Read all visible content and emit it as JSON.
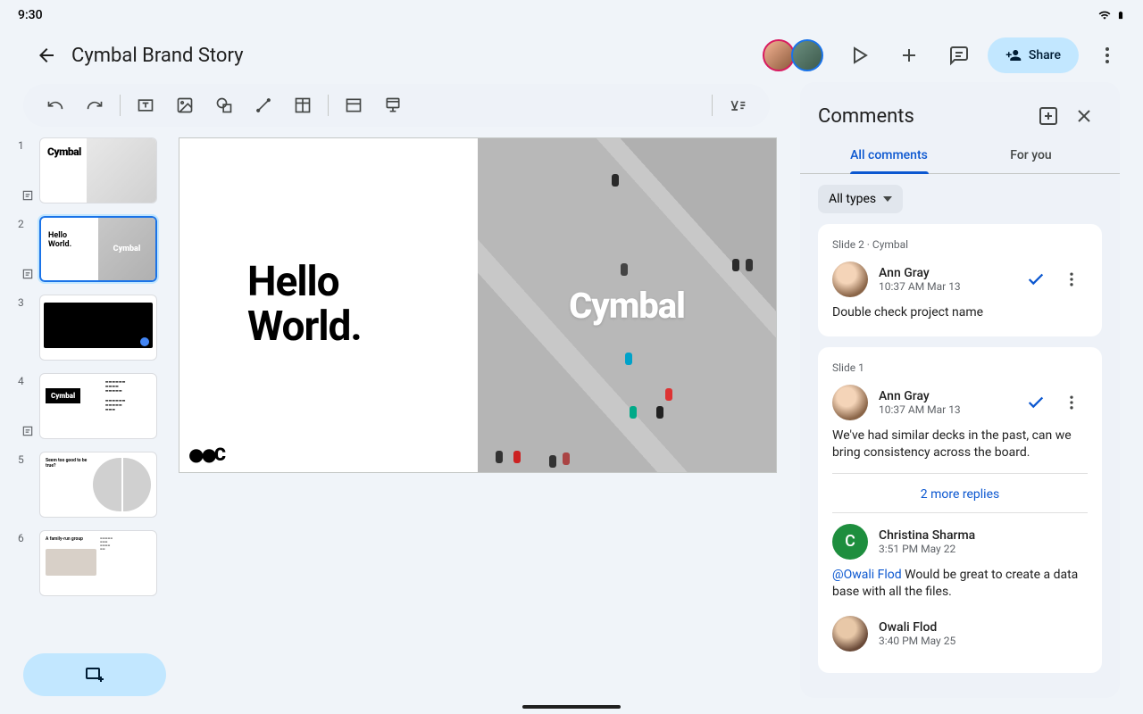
{
  "status": {
    "time": "9:30"
  },
  "header": {
    "title": "Cymbal Brand Story",
    "share_label": "Share"
  },
  "canvas": {
    "title_line1": "Hello",
    "title_line2": "World.",
    "brand": "Cymbal",
    "corner_mark": "⚫⚫C"
  },
  "thumbnails": [
    {
      "num": "1",
      "logo": "Cymbal"
    },
    {
      "num": "2",
      "text": "Hello\nWorld.",
      "logo": "Cymbal"
    },
    {
      "num": "3"
    },
    {
      "num": "4",
      "logo": "Cymbal"
    },
    {
      "num": "5",
      "text": "Seem too good\nto be true?"
    },
    {
      "num": "6",
      "text": "A family-run\ngroup"
    }
  ],
  "comments": {
    "title": "Comments",
    "tabs": {
      "all": "All comments",
      "for_you": "For you"
    },
    "filter": "All types",
    "cards": [
      {
        "slide": "Slide 2 · Cymbal",
        "author": "Ann Gray",
        "time": "10:37 AM Mar 13",
        "text": "Double check project name"
      },
      {
        "slide": "Slide 1",
        "author": "Ann Gray",
        "time": "10:37 AM Mar 13",
        "text": "We've had similar decks in the past, can we bring consistency across the board.",
        "replies_label": "2 more replies",
        "replies": [
          {
            "author": "Christina Sharma",
            "time": "3:51 PM May 22",
            "mention": "@Owali Flod",
            "text": " Would be great to create a data base with all the files."
          },
          {
            "author": "Owali Flod",
            "time": "3:40 PM May 25"
          }
        ]
      }
    ]
  }
}
